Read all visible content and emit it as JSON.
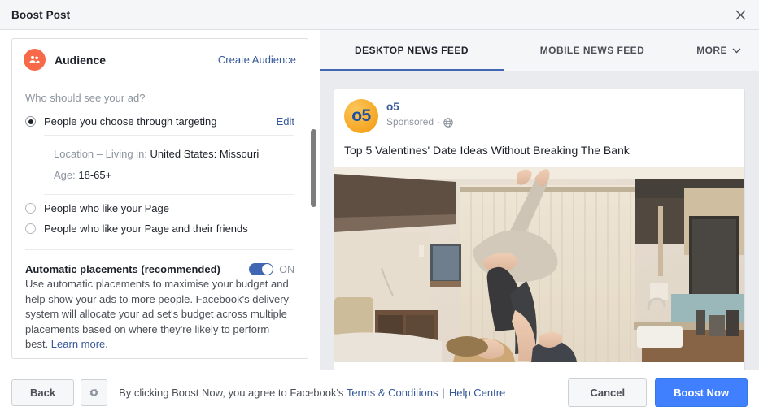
{
  "window": {
    "title": "Boost Post",
    "close_icon": "close-icon"
  },
  "audience_card": {
    "icon": "people-icon",
    "title": "Audience",
    "create_link": "Create Audience",
    "question": "Who should see your ad?",
    "options": [
      {
        "label": "People you choose through targeting",
        "selected": true,
        "edit_label": "Edit"
      },
      {
        "label": "People who like your Page",
        "selected": false
      },
      {
        "label": "People who like your Page and their friends",
        "selected": false
      }
    ],
    "details": [
      {
        "key": "Location – Living in:",
        "value": "United States: Missouri"
      },
      {
        "key": "Age:",
        "value": "18-65+"
      }
    ]
  },
  "placements": {
    "title": "Automatic placements (recommended)",
    "toggle_state": "ON",
    "toggle_on": true,
    "description": "Use automatic placements to maximise your budget and help show your ads to more people. Facebook's delivery system will allocate your ad set's budget across multiple placements based on where they're likely to perform best. ",
    "learn_more": "Learn more",
    "period": "."
  },
  "preview": {
    "tabs": [
      {
        "label": "DESKTOP NEWS FEED",
        "active": true
      },
      {
        "label": "MOBILE NEWS FEED",
        "active": false
      },
      {
        "label": "MORE",
        "active": false,
        "icon": "chevron-down-icon"
      }
    ],
    "ad": {
      "avatar_text": "o5",
      "page_name": "o5",
      "sponsored_label": "Sponsored",
      "separator": "·",
      "privacy_icon": "globe-icon",
      "headline": "Top 5 Valentines' Date Ideas Without Breaking The Bank"
    }
  },
  "footer": {
    "back_label": "Back",
    "settings_icon": "gear-icon",
    "legal_prefix": "By clicking Boost Now, you agree to Facebook's ",
    "terms_link": "Terms & Conditions",
    "separator": "|",
    "help_link": "Help Centre",
    "cancel_label": "Cancel",
    "boost_label": "Boost Now"
  },
  "colors": {
    "primary": "#4080ff",
    "link": "#365899",
    "accent_blue": "#4267b2",
    "audience_icon_bg": "#f8694a",
    "preview_bg": "#e9ebee"
  }
}
